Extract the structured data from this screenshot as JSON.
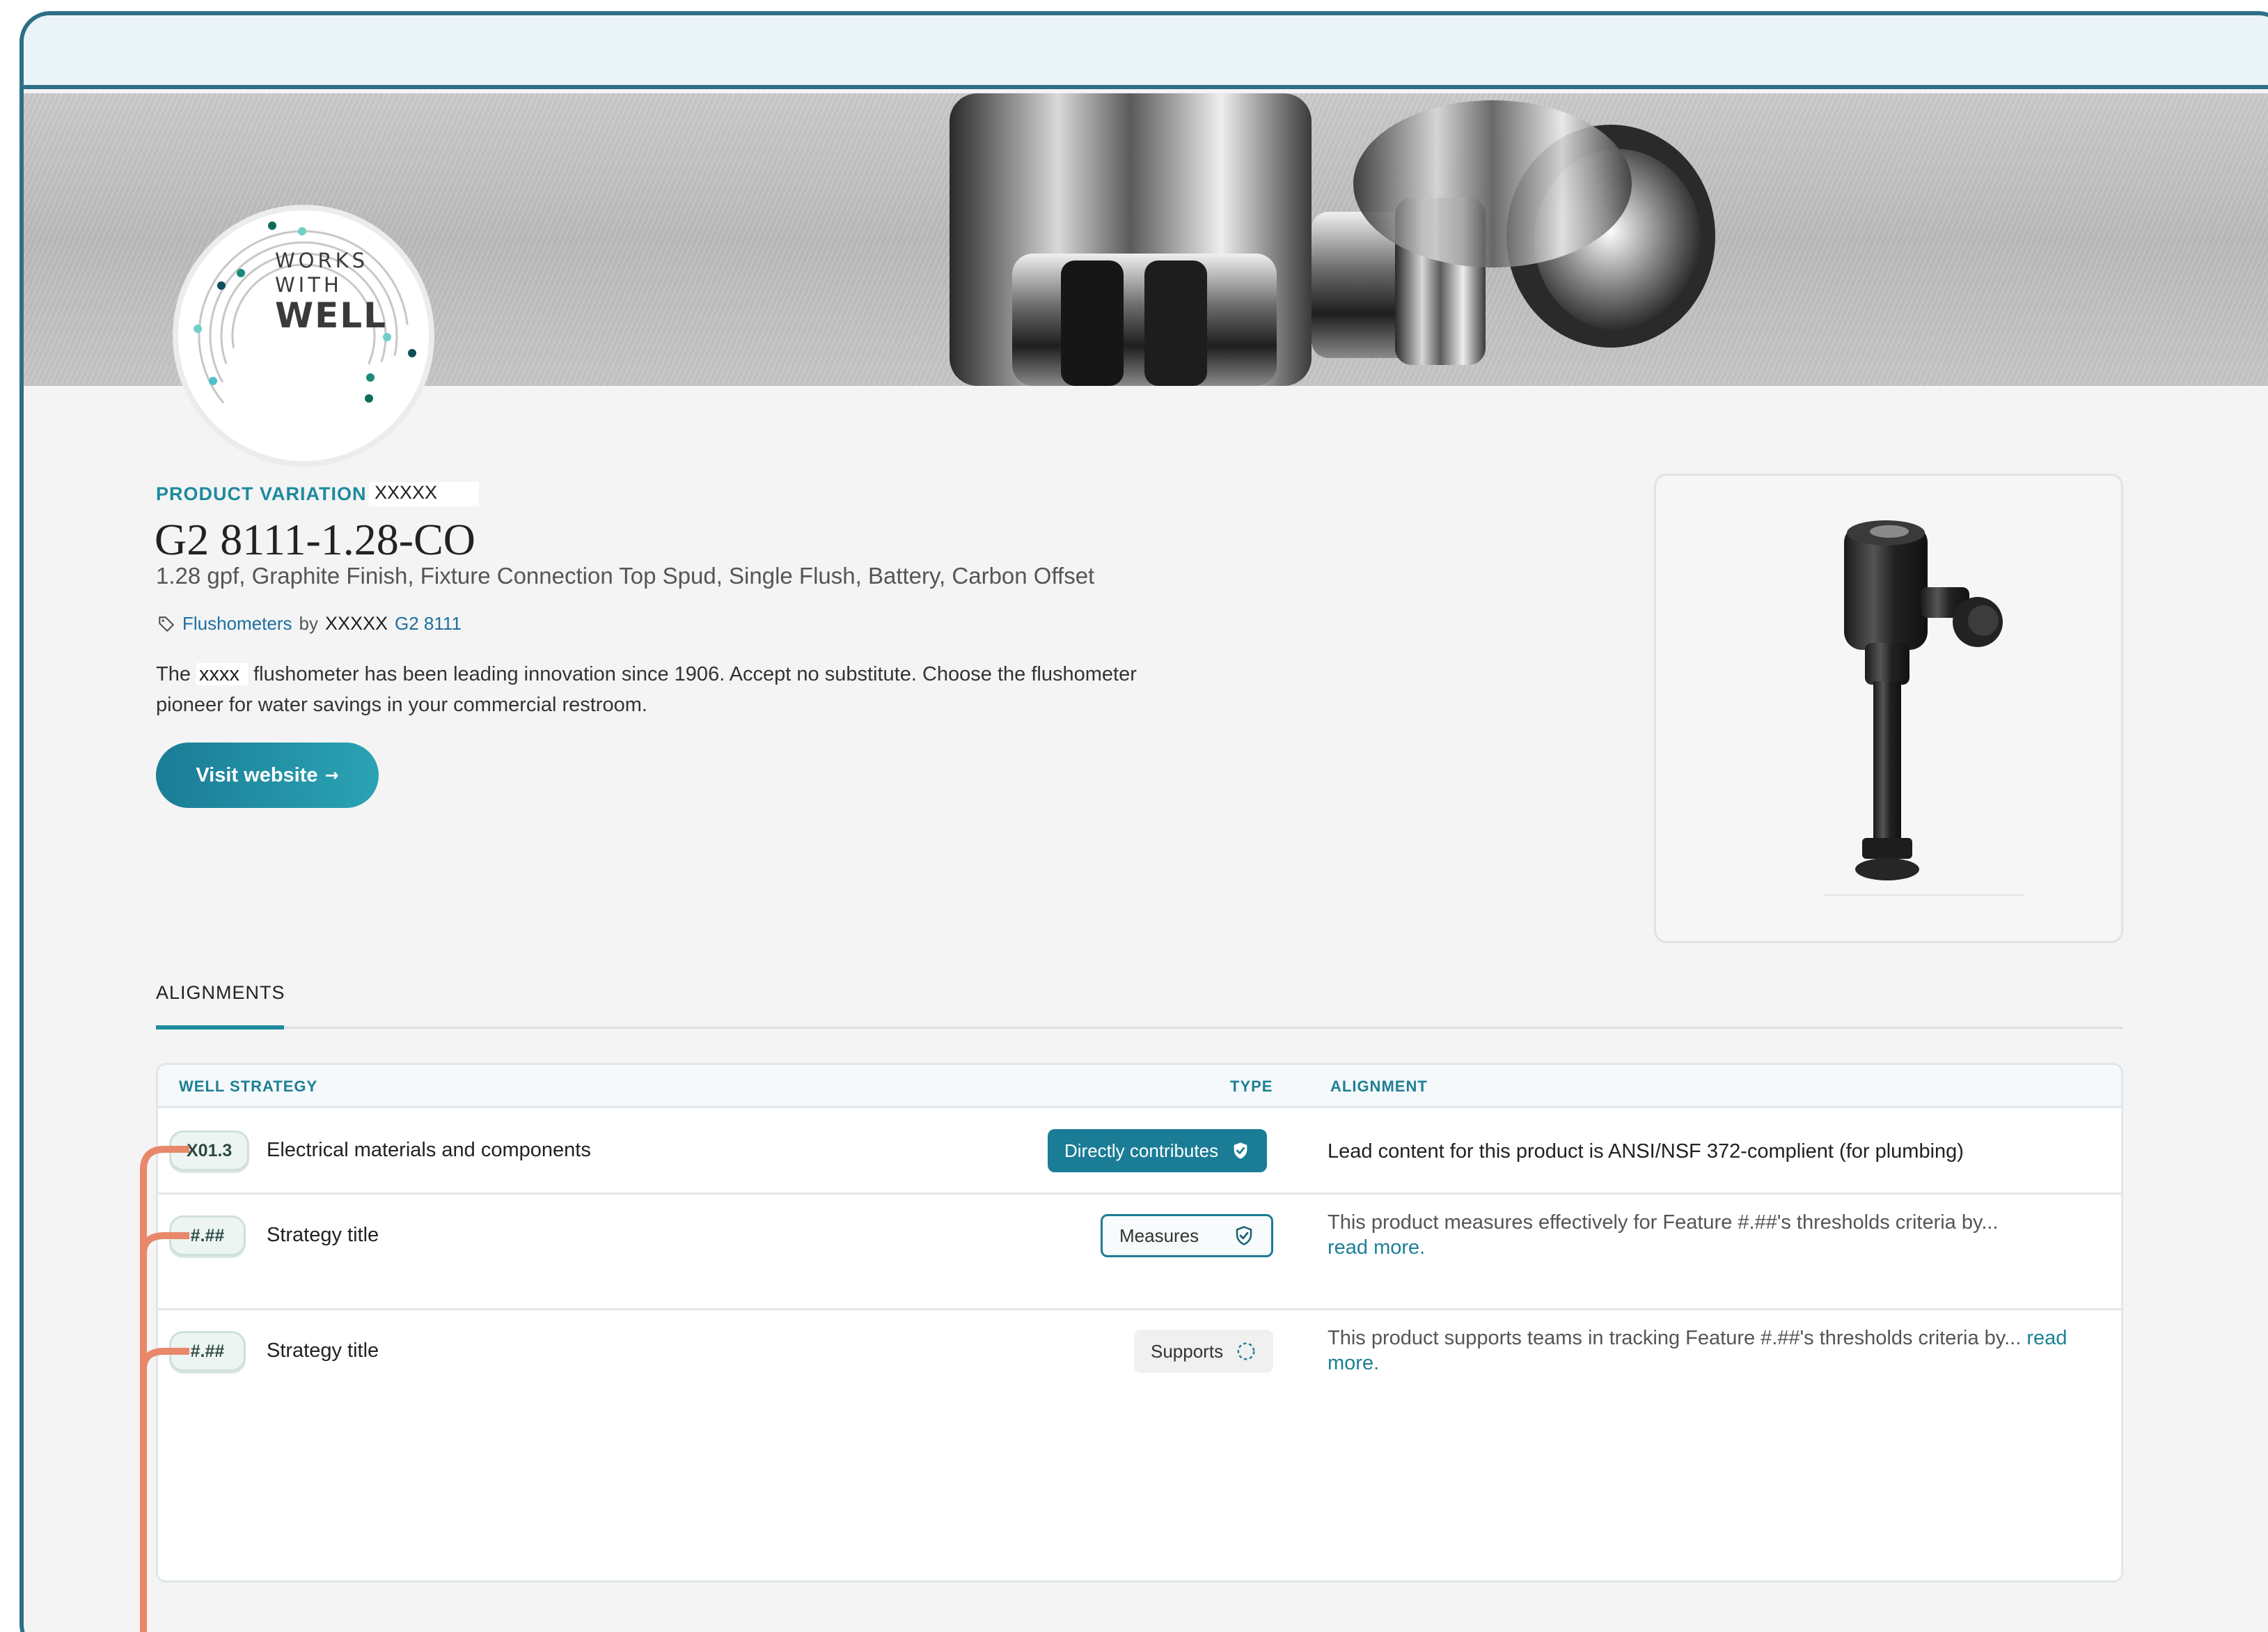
{
  "header": {},
  "badge": {
    "line1": "WORKS",
    "line2": "WITH",
    "line3": "WELL"
  },
  "product": {
    "variation_label": "PRODUCT VARIATION",
    "variation_value": "XXXXX",
    "title": "G2 8111-1.28-CO",
    "subtitle": "1.28 gpf, Graphite Finish, Fixture Connection Top Spud, Single Flush, Battery, Carbon Offset",
    "category_link": "Flushometers",
    "by": "by",
    "brand": "XXXXX",
    "model_link": "G2 8111",
    "description_pre": "The",
    "description_redacted": "xxxx",
    "description_post": "flushometer has been leading innovation since 1906. Accept no substitute. Choose the flushometer pioneer for water savings in your commercial restroom.",
    "visit_button": "Visit website",
    "visit_arrow": "→"
  },
  "alignments": {
    "tab_label": "ALIGNMENTS",
    "columns": {
      "strategy": "WELL STRATEGY",
      "type": "TYPE",
      "alignment": "ALIGNMENT"
    },
    "rows": [
      {
        "code": "X01.3",
        "strategy": "Electrical materials and components",
        "type": "Directly contributes",
        "alignment": "Lead content for this product is ANSI/NSF 372-complient (for plumbing)",
        "read_more": ""
      },
      {
        "code": "#.##",
        "strategy": "Strategy title",
        "type": "Measures",
        "alignment": "This product measures effectively for Feature #.##'s thresholds criteria by...",
        "read_more": "read more."
      },
      {
        "code": "#.##",
        "strategy": "Strategy title",
        "type": "Supports",
        "alignment": "This product supports teams in tracking Feature #.##'s thresholds criteria by...",
        "read_more": "read more."
      }
    ]
  },
  "colors": {
    "accent": "#1b7c96",
    "frame": "#2e6f85",
    "connector": "#e8876a"
  }
}
